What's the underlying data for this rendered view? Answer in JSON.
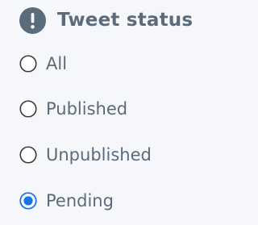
{
  "filter": {
    "title": "Tweet status",
    "header_icon": "exclamation-circle-icon",
    "colors": {
      "text": "#5b6b7a",
      "radio_border": "#3a3a3a",
      "radio_selected": "#1a73e8",
      "background": "#f5f7fa"
    },
    "options": [
      {
        "label": "All",
        "selected": false
      },
      {
        "label": "Published",
        "selected": false
      },
      {
        "label": "Unpublished",
        "selected": false
      },
      {
        "label": "Pending",
        "selected": true
      }
    ]
  }
}
